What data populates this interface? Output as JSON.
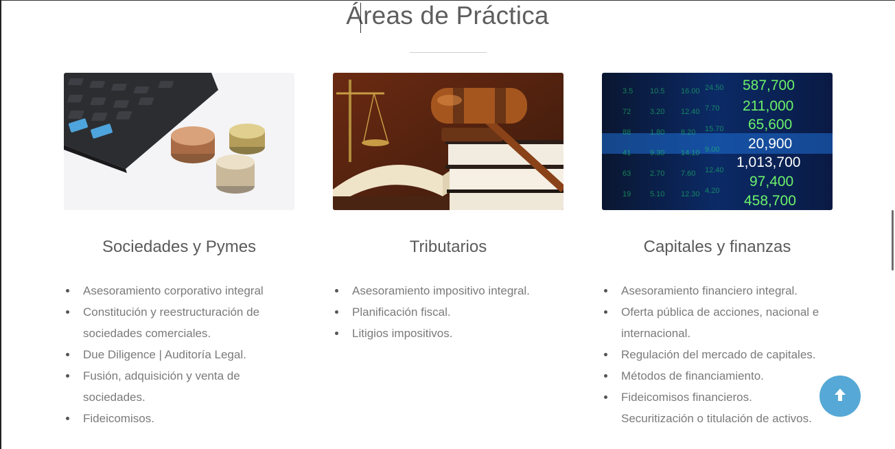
{
  "section": {
    "title": "Áreas de Práctica"
  },
  "cards": [
    {
      "title": "Sociedades y Pymes",
      "image_icon": "calculator-coins-image",
      "items": [
        "Asesoramiento corporativo integral",
        "Constitución y reestructuración de sociedades comerciales.",
        "Due Diligence | Auditoría Legal.",
        "Fusión, adquisición y venta de sociedades.",
        "Fideicomisos."
      ]
    },
    {
      "title": "Tributarios",
      "image_icon": "gavel-books-image",
      "items": [
        "Asesoramiento impositivo integral.",
        "Planificación fiscal.",
        "Litigios impositivos."
      ]
    },
    {
      "title": "Capitales y finanzas",
      "image_icon": "stock-ticker-image",
      "ticker_values": [
        "587,700",
        "211,000",
        "65,600",
        "20,900",
        "1,013,700",
        "97,400",
        "458,700"
      ],
      "items": [
        "Asesoramiento financiero integral.",
        "Oferta pública de acciones, nacional e internacional.",
        "Regulación del mercado de capitales.",
        "Métodos de financiamiento.",
        "Fideicomisos financieros. Securitización o titulación de activos."
      ]
    }
  ],
  "scroll_top_button": {
    "icon": "arrow-up-icon",
    "color": "#56a9d6"
  }
}
